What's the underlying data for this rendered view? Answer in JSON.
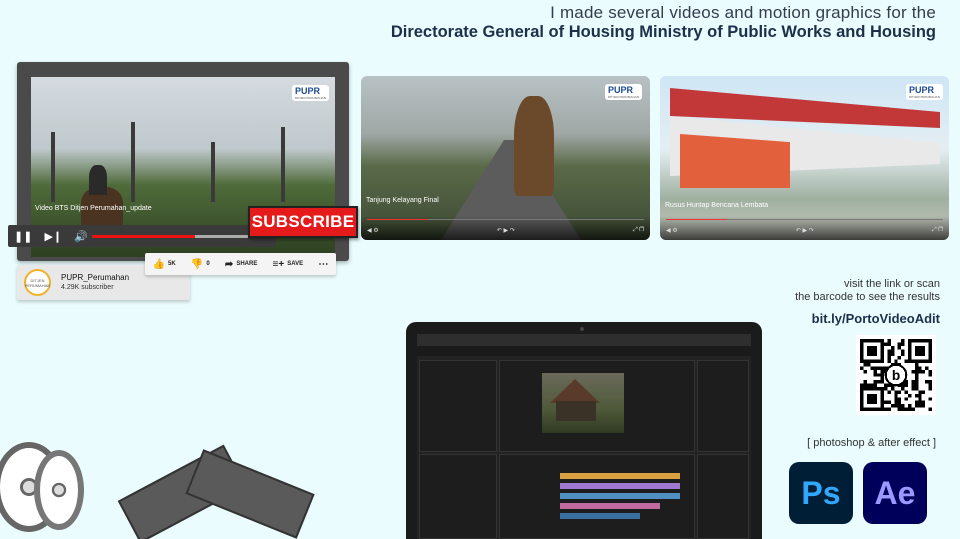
{
  "header": {
    "line1": "I made several videos and motion graphics for the",
    "line2": "Directorate General of Housing Ministry of Public Works and Housing"
  },
  "youtube": {
    "video_title": "Video BTS Ditjen Perumahan_update",
    "subscribe_label": "SUBSCRIBE",
    "channel_name": "PUPR_Perumahan",
    "subscribers": "4.29K subscriber",
    "like_count": "5K",
    "dislike_count": "0",
    "share_label": "SHARE",
    "save_label": "SAVE",
    "progress": 0.6,
    "logo_text": "PUPR",
    "avatar_text": "DITJEN PERUMAHAN"
  },
  "videos": [
    {
      "caption": "Tanjung Kelayang Final"
    },
    {
      "caption": "Rusus Huntap Bencana Lembata"
    }
  ],
  "cta": {
    "visit_line1": "visit the link or scan",
    "visit_line2": "the barcode to see the results",
    "link": "bit.ly/PortoVideoAdit"
  },
  "tools": {
    "label": "[ photoshop & after effect ]",
    "ps": "Ps",
    "ae": "Ae"
  },
  "colors": {
    "background": "#eafcfd",
    "subscribe": "#e51b1b",
    "ps_bg": "#001e36",
    "ae_bg": "#00005b"
  }
}
